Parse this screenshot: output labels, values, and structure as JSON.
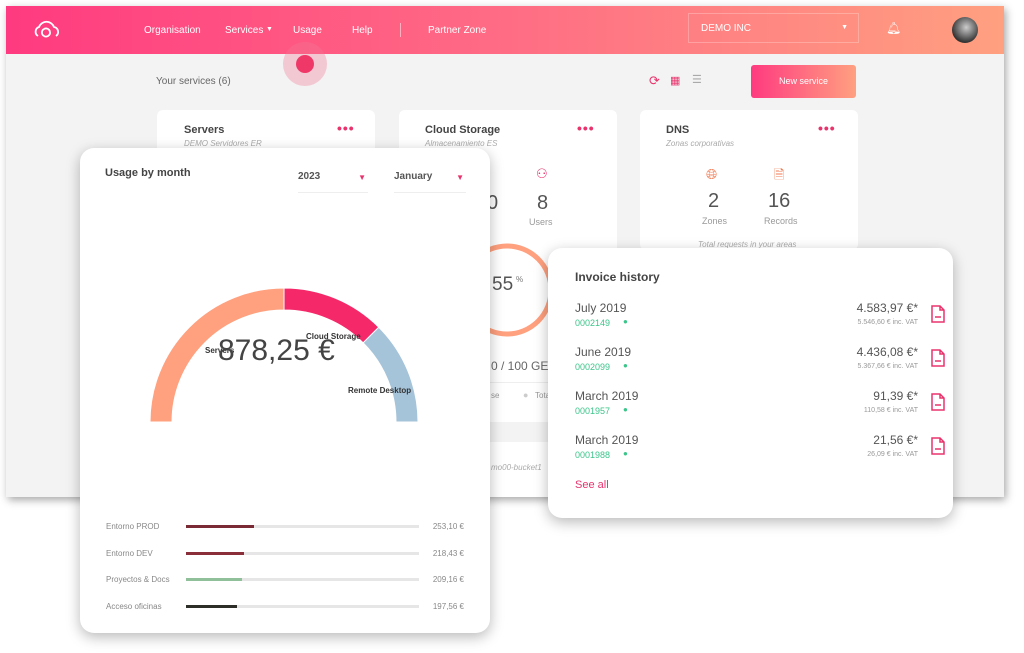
{
  "header": {
    "nav": [
      "Organisation",
      "Services",
      "Usage",
      "Help",
      "Partner Zone"
    ],
    "org_select": "DEMO INC"
  },
  "toolbar": {
    "title": "Your services (6)",
    "new_service": "New service"
  },
  "cards": [
    {
      "title": "Servers",
      "subtitle": "DEMO Servidores ER"
    },
    {
      "title": "Cloud Storage",
      "subtitle": "Almacenamiento ES",
      "stat_partial": "0",
      "users": "8",
      "users_label": "Users",
      "ring_value": "55",
      "ring_unit": "%",
      "storage_partial": "0 / 100 GE",
      "legend_partial_1": "se",
      "legend_partial_2": "Tota",
      "bucket_partial": "mo00-bucket1"
    },
    {
      "title": "DNS",
      "subtitle": "Zonas corporativas",
      "zones": "2",
      "zones_label": "Zones",
      "records": "16",
      "records_label": "Records",
      "footer": "Total requests in your areas"
    }
  ],
  "usage": {
    "title": "Usage by month",
    "year": "2023",
    "month": "January",
    "total": "878,25 €",
    "rows": [
      {
        "label": "Entorno PROD",
        "amount": "253,10 €",
        "fraction": 0.29,
        "color": "#7a2a35"
      },
      {
        "label": "Entorno DEV",
        "amount": "218,43 €",
        "fraction": 0.25,
        "color": "#8a2f3a"
      },
      {
        "label": "Proyectos & Docs",
        "amount": "209,16 €",
        "fraction": 0.24,
        "color": "#8fc09a"
      },
      {
        "label": "Acceso oficinas",
        "amount": "197,56 €",
        "fraction": 0.22,
        "color": "#2e2e28"
      }
    ]
  },
  "chart_data": {
    "type": "pie",
    "variant": "semi-donut",
    "series": [
      {
        "name": "Servers",
        "share": 0.5,
        "color": "#ffa07e"
      },
      {
        "name": "Cloud Storage",
        "share": 0.25,
        "color": "#f5286a"
      },
      {
        "name": "Remote Desktop",
        "share": 0.25,
        "color": "#a5c3d9"
      }
    ],
    "center_label": "878,25 €"
  },
  "invoices": {
    "title": "Invoice history",
    "see_all": "See all",
    "items": [
      {
        "month": "July 2019",
        "number": "0002149",
        "amount": "4.583,97 €*",
        "vat": "5.546,60 € inc. VAT"
      },
      {
        "month": "June 2019",
        "number": "0002099",
        "amount": "4.436,08 €*",
        "vat": "5.367,66 € inc. VAT"
      },
      {
        "month": "March 2019",
        "number": "0001957",
        "amount": "91,39 €*",
        "vat": "110,58 € inc. VAT"
      },
      {
        "month": "March 2019",
        "number": "0001988",
        "amount": "21,56 €*",
        "vat": "26,09 € inc. VAT"
      }
    ]
  },
  "colors": {
    "accent": "#e8336d",
    "green": "#3cc58a"
  }
}
